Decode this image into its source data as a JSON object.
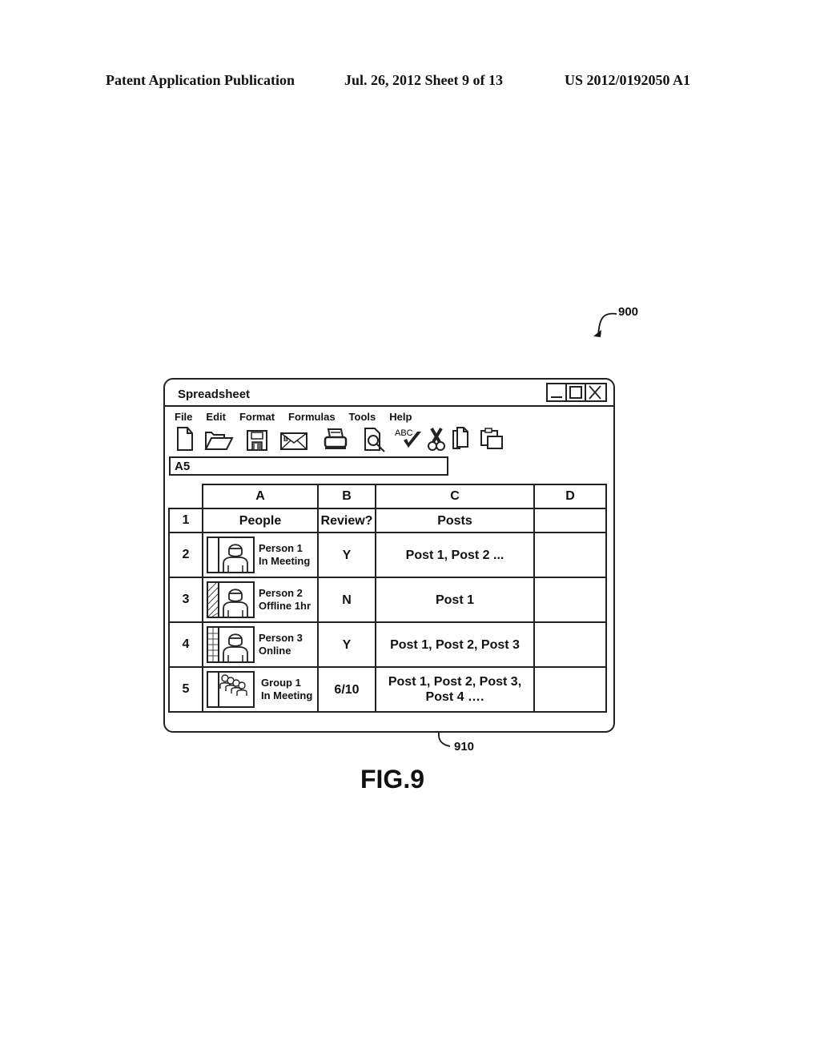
{
  "patent_header": {
    "publication": "Patent Application Publication",
    "date_sheet": "Jul. 26, 2012   Sheet 9 of 13",
    "number": "US 2012/0192050 A1"
  },
  "reference_labels": {
    "window": "900",
    "posts_cell": "910"
  },
  "figure_caption": "FIG.9",
  "window": {
    "title": "Spreadsheet",
    "controls": [
      {
        "name": "minimize",
        "icon": "minimize-icon"
      },
      {
        "name": "maximize",
        "icon": "maximize-icon"
      },
      {
        "name": "close",
        "icon": "close-icon"
      }
    ],
    "menu": [
      "File",
      "Edit",
      "Format",
      "Formulas",
      "Tools",
      "Help"
    ],
    "toolbar": [
      {
        "name": "new",
        "icon": "new-document-icon"
      },
      {
        "name": "open",
        "icon": "open-folder-icon"
      },
      {
        "name": "save",
        "icon": "floppy-disk-icon"
      },
      {
        "name": "email",
        "icon": "envelope-icon"
      },
      {
        "name": "print",
        "icon": "printer-icon"
      },
      {
        "name": "print-preview",
        "icon": "magnifier-document-icon"
      },
      {
        "name": "spell-check",
        "icon": "abc-checkmark-icon",
        "text": "ABC"
      },
      {
        "name": "cut",
        "icon": "scissors-icon"
      },
      {
        "name": "copy",
        "icon": "copy-icon"
      },
      {
        "name": "paste",
        "icon": "paste-icon"
      }
    ],
    "name_box": "A5"
  },
  "sheet": {
    "column_headers": [
      "A",
      "B",
      "C",
      "D"
    ],
    "rows": [
      {
        "row": "1",
        "A": {
          "text": "People"
        },
        "B": "Review?",
        "C": "Posts",
        "D": ""
      },
      {
        "row": "2",
        "A": {
          "name": "Person 1",
          "status": "In Meeting",
          "status_indicator": "blank",
          "avatar": "person-avatar-icon"
        },
        "B": "Y",
        "C": "Post 1, Post 2 ...",
        "D": ""
      },
      {
        "row": "3",
        "A": {
          "name": "Person 2",
          "status": "Offline 1hr",
          "status_indicator": "hatched",
          "avatar": "person-avatar-icon"
        },
        "B": "N",
        "C": "Post 1",
        "D": ""
      },
      {
        "row": "4",
        "A": {
          "name": "Person 3",
          "status": "Online",
          "status_indicator": "grid",
          "avatar": "person-avatar-icon"
        },
        "B": "Y",
        "C": "Post 1, Post 2, Post 3",
        "D": ""
      },
      {
        "row": "5",
        "A": {
          "name": "Group 1",
          "status": "In Meeting",
          "status_indicator": "blank",
          "avatar": "group-avatar-icon"
        },
        "B": "6/10",
        "C": "Post 1, Post 2, Post 3, Post 4 ….",
        "D": ""
      }
    ]
  }
}
